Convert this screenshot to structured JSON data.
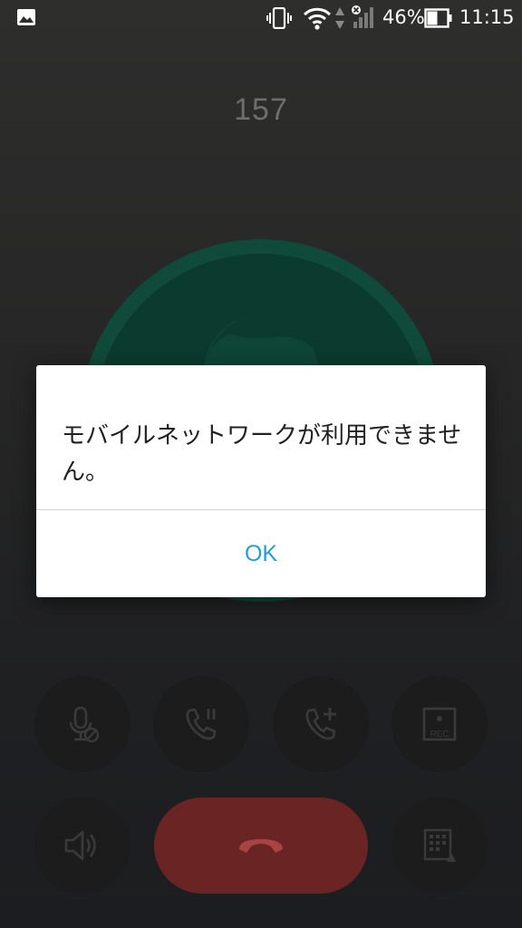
{
  "status_bar": {
    "battery": "46%",
    "time": "11:15",
    "icons": [
      "image-icon",
      "vibrate-icon",
      "wifi-icon",
      "data-arrows-icon",
      "signal-no-service-icon",
      "battery-icon"
    ]
  },
  "call": {
    "number": "157"
  },
  "controls": {
    "icons": [
      "mute-mic-icon",
      "hold-call-icon",
      "add-call-icon",
      "record-icon",
      "speaker-icon",
      "end-call-icon",
      "dialpad-icon"
    ],
    "record_label": "REC"
  },
  "dialog": {
    "message": "モバイルネットワークが利用できません。",
    "ok_label": "OK"
  },
  "colors": {
    "avatar_ring": "#0f4a3a",
    "end_call": "#6b2424",
    "accent": "#1ea0d8"
  }
}
